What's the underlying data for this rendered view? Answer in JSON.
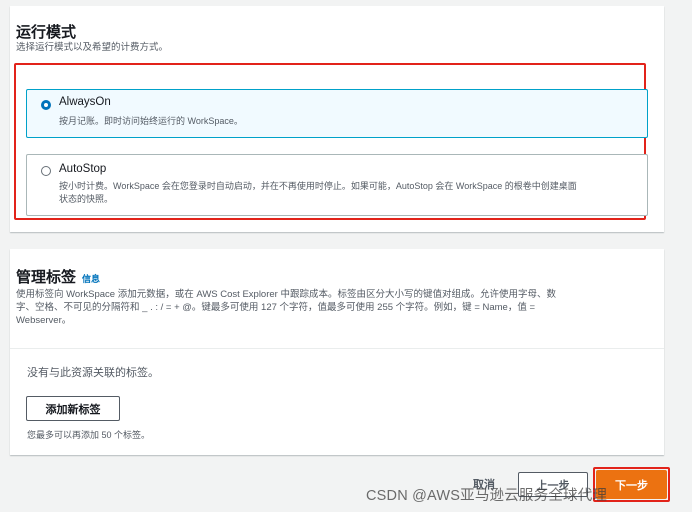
{
  "running_mode": {
    "title": "运行模式",
    "description": "选择运行模式以及希望的计费方式。",
    "options": [
      {
        "label": "AlwaysOn",
        "description": "按月记账。即时访问始终运行的 WorkSpace。",
        "selected": true
      },
      {
        "label": "AutoStop",
        "description_line1": "按小时计费。WorkSpace 会在您登录时自动启动，并在不再使用时停止。如果可能，AutoStop 会在 WorkSpace 的根卷中创建桌面",
        "description_line2": "状态的快照。",
        "selected": false
      }
    ]
  },
  "tags": {
    "title": "管理标签",
    "info": "信息",
    "description_line1": "使用标签向 WorkSpace 添加元数据，或在 AWS Cost Explorer 中跟踪成本。标签由区分大小写的键值对组成。允许使用字母、数",
    "description_line2": "字、空格、不可见的分隔符和 _ . : / = + @。键最多可使用 127 个字符，值最多可使用 255 个字符。例如，键 = Name，值 =",
    "description_line3": "Webserver。",
    "empty_text": "没有与此资源关联的标签。",
    "add_button": "添加新标签",
    "limit_text": "您最多可以再添加 50 个标签。"
  },
  "footer": {
    "cancel": "取消",
    "previous": "上一步",
    "next": "下一步"
  },
  "watermark": "CSDN @AWS亚马逊云服务全球代理",
  "colors": {
    "primary": "#ec7211",
    "selected_border": "#00a1c9",
    "radio": "#0073bb",
    "highlight": "#e2231a"
  }
}
